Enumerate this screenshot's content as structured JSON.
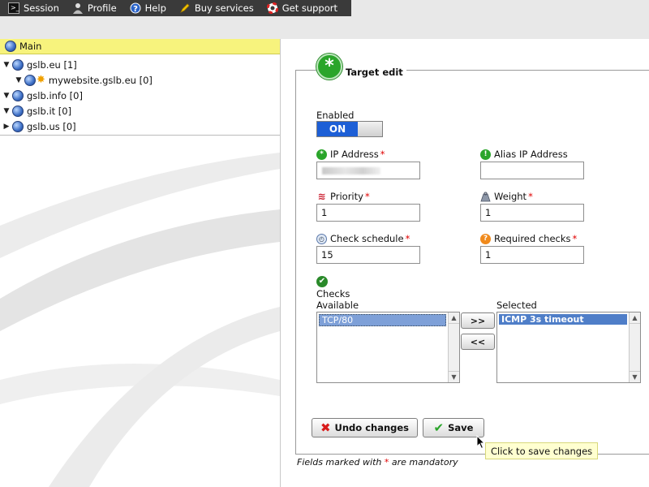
{
  "menu": {
    "items": [
      {
        "label": "Session",
        "icon": "terminal-icon"
      },
      {
        "label": "Profile",
        "icon": "user-icon"
      },
      {
        "label": "Help",
        "icon": "help-icon"
      },
      {
        "label": "Buy services",
        "icon": "pencil-icon"
      },
      {
        "label": "Get support",
        "icon": "lifebuoy-icon"
      }
    ]
  },
  "tree": {
    "header": "Main",
    "nodes": [
      {
        "label": "gslb.eu [1]",
        "expanded": true
      },
      {
        "label": "mywebsite.gslb.eu [0]",
        "expanded": true
      },
      {
        "label": "gslb.info [0]",
        "expanded": true
      },
      {
        "label": "gslb.it [0]",
        "expanded": true
      },
      {
        "label": "gslb.us [0]",
        "expanded": false
      }
    ]
  },
  "form": {
    "title": "Target edit",
    "enabled_label": "Enabled",
    "toggle_on_label": "ON",
    "ip_label": "IP Address",
    "ip_value": "",
    "alias_label": "Alias IP Address",
    "alias_value": "",
    "priority_label": "Priority",
    "priority_value": "1",
    "weight_label": "Weight",
    "weight_value": "1",
    "schedule_label": "Check schedule",
    "schedule_value": "15",
    "required_label": "Required checks",
    "required_value": "1",
    "checks_label": "Checks",
    "available_label": "Available",
    "selected_label": "Selected",
    "available_items": [
      "TCP/80"
    ],
    "selected_items": [
      "ICMP 3s timeout"
    ],
    "move_right_label": ">>",
    "move_left_label": "<<",
    "undo_label": "Undo changes",
    "save_label": "Save",
    "required_marker": "*",
    "mandatory_note_pre": "Fields marked with",
    "mandatory_note_post": "are mandatory"
  },
  "tooltip": "Click to save changes",
  "colors": {
    "menu_bg": "#3a3a3a",
    "tree_header_bg": "#f7f37d",
    "toggle_on": "#1d5fd6",
    "list_selection": "#4f7ec8",
    "required": "#e00000",
    "tooltip_bg": "#ffffd0"
  }
}
